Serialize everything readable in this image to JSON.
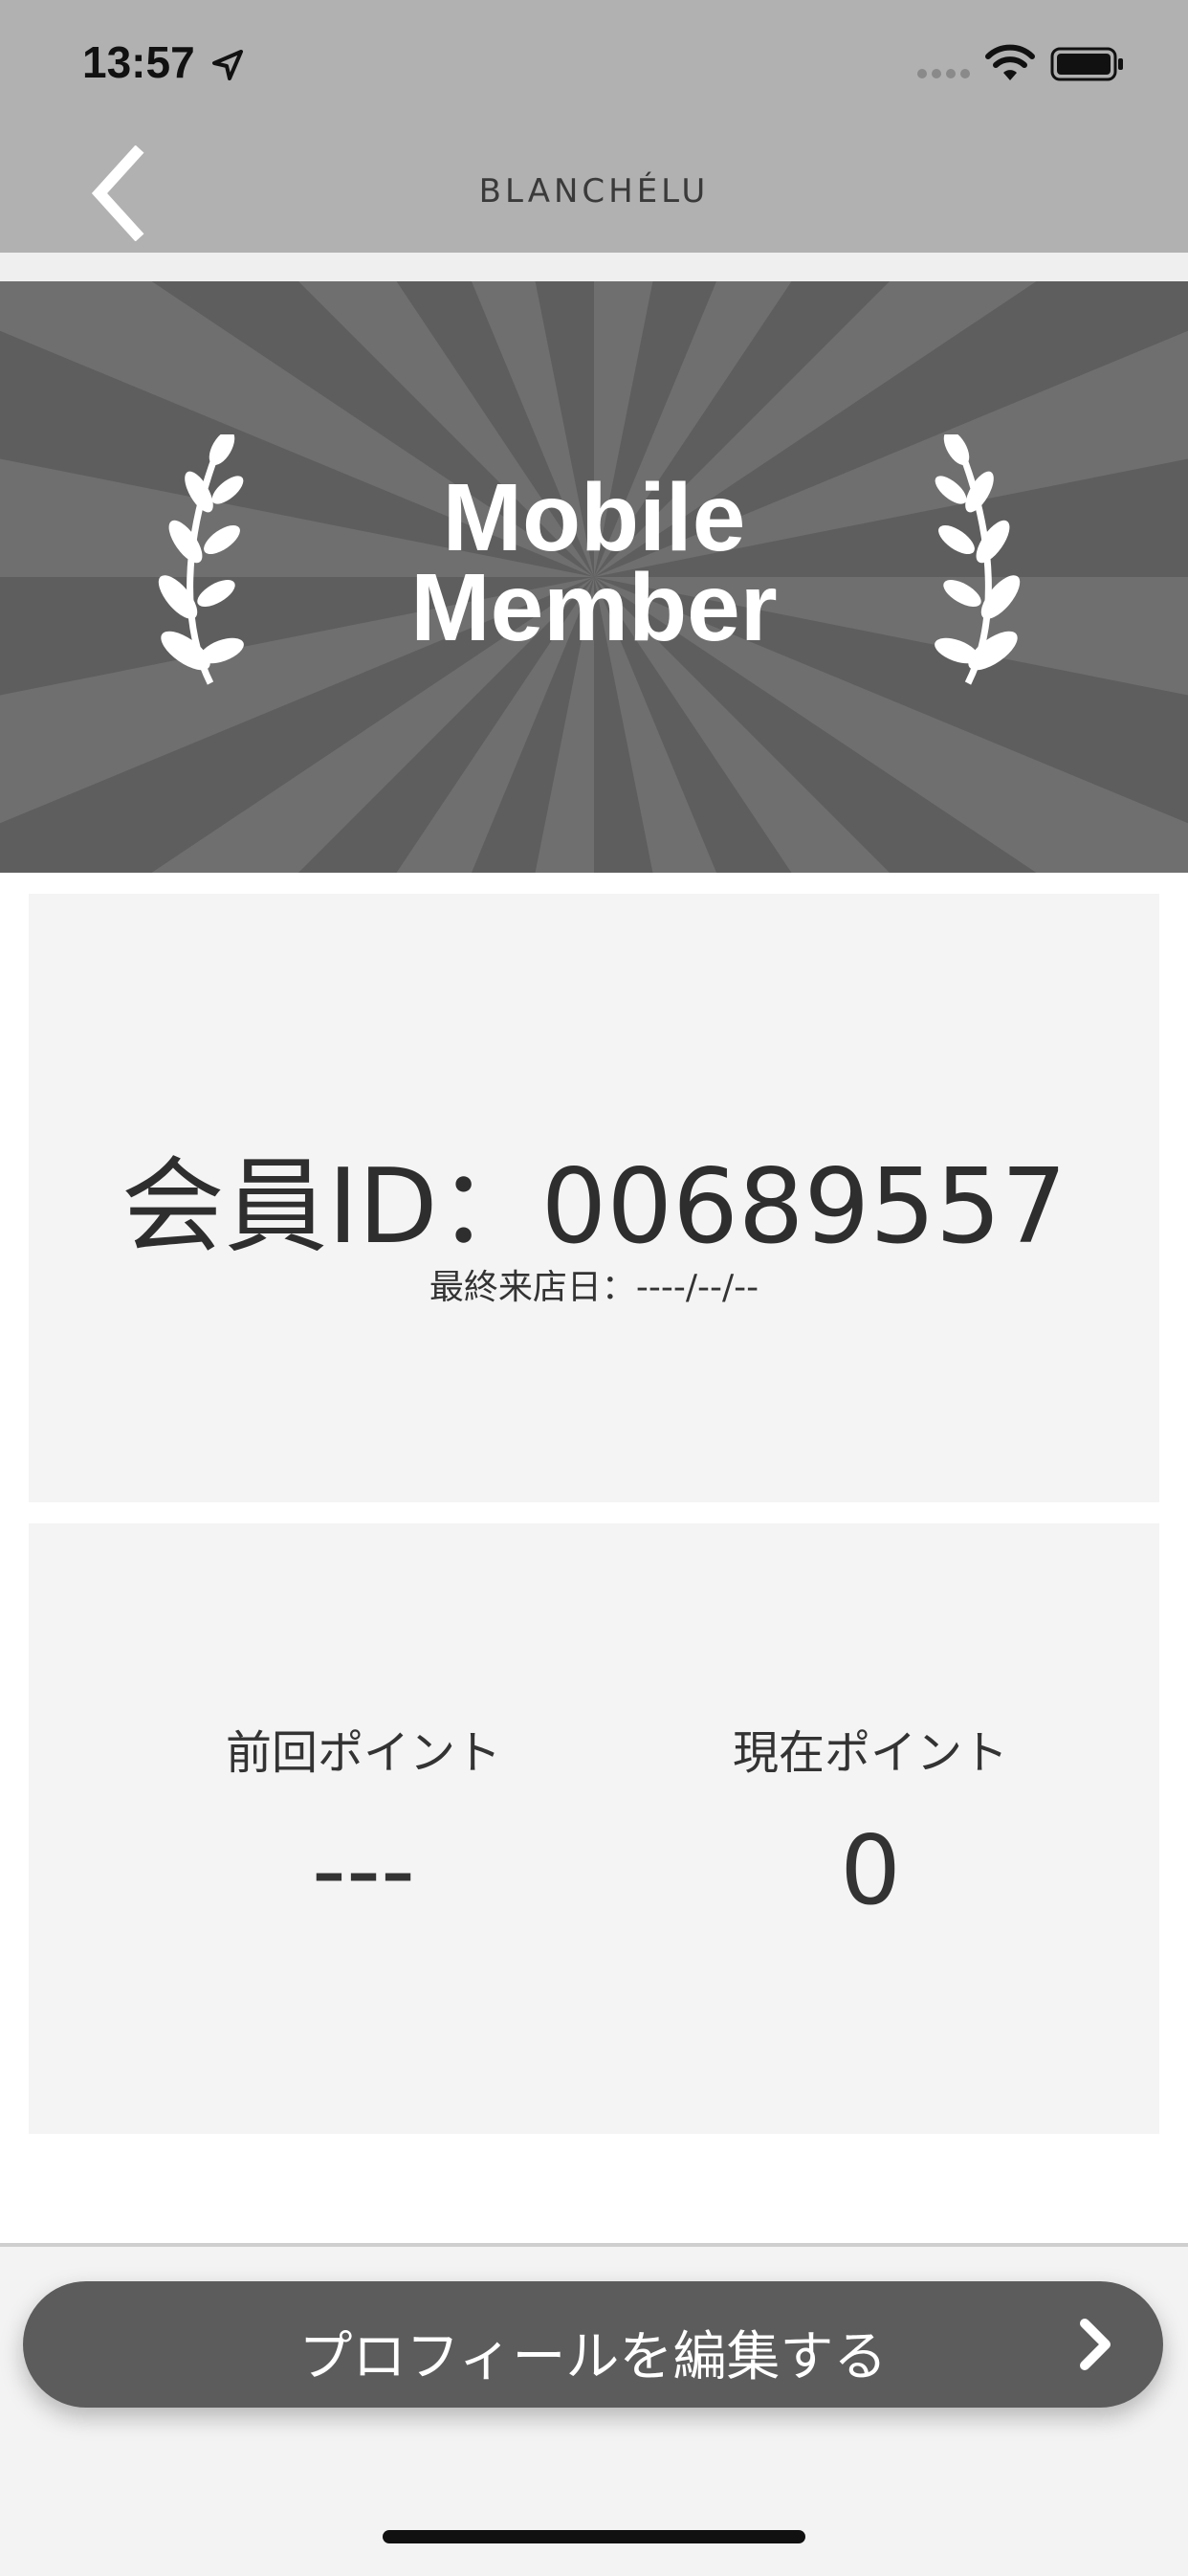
{
  "status_bar": {
    "time": "13:57",
    "icons": [
      "location-arrow-icon",
      "signal-icon",
      "wifi-icon",
      "battery-icon"
    ]
  },
  "nav": {
    "title": "BLANCHÉLU",
    "back_icon": "chevron-left-icon"
  },
  "banner": {
    "title_line1": "Mobile",
    "title_line2": "Member",
    "icons": [
      "laurel-icon"
    ]
  },
  "member": {
    "id_text": "会員ID：00689557",
    "last_visit": "最終来店日：----/--/--"
  },
  "points": {
    "previous_label": "前回ポイント",
    "previous_value": "---",
    "current_label": "現在ポイント",
    "current_value": "0"
  },
  "footer": {
    "edit_button_label": "プロフィールを編集する",
    "edit_button_icon": "chevron-right-icon"
  },
  "colors": {
    "header_bg": "#b1b1b1",
    "banner_bg": "#5e5e5e",
    "card_bg": "#f4f4f4",
    "button_bg": "#5c5c5c"
  }
}
